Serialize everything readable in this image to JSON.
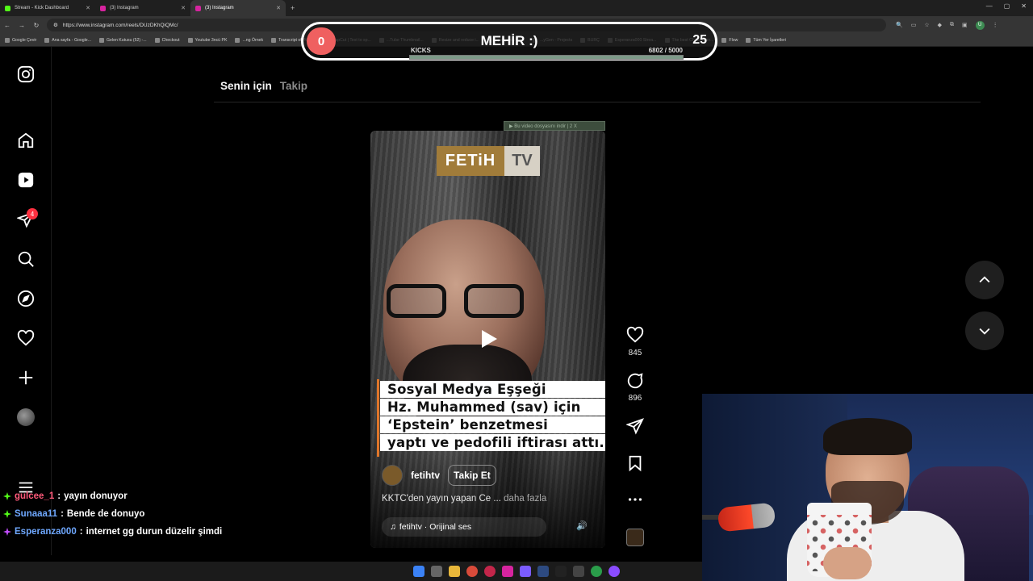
{
  "browser": {
    "tabs": [
      {
        "label": "Stream - Kick Dashboard",
        "color": "#53fc18"
      },
      {
        "label": "(3) Instagram",
        "color": "#d6249f"
      },
      {
        "label": "(3) Instagram",
        "color": "#d6249f"
      }
    ],
    "url": "https://www.instagram.com/reels/DUzDKhQiQMc/",
    "bookmarks": [
      "Google Çevir",
      "Ana sayfa - Google...",
      "Gelen Kutusu (52) -...",
      "Checkout",
      "Youtube 3ncü PK",
      "...ng Örnek",
      "Transcript of \"Ml M...",
      "CapCut | Text to sp...",
      "...Tube Thumbnail...",
      "Resize and reduce i...",
      "İspanyolca Öz...",
      "...yGen - Projects",
      "BURÇ",
      "Esperanza000 Strea...",
      "The best ChatBot an...",
      "Flow",
      "Tüm Yer İşaretleri"
    ]
  },
  "kick_overlay": {
    "left_value": "0",
    "title": "MEHİR :)",
    "right_value": "25",
    "label": "KICKS",
    "count_text": "6802  / 5000",
    "progress_fraction": 1.0,
    "color": "#ef6060"
  },
  "instagram": {
    "sidebar": {
      "notification_count": "4",
      "items": [
        "instagram-logo",
        "home",
        "reels",
        "messages",
        "search",
        "explore",
        "notifications",
        "create",
        "profile",
        "more"
      ]
    },
    "feed_tabs": {
      "active": "Senin için",
      "inactive": "Takip"
    },
    "reel": {
      "download_banner": "▶ Bu video dosyasını indir  | 2 X",
      "logo_left": "FETiH",
      "logo_right": "TV",
      "caption_lines": [
        "Sosyal Medya Eşşeği",
        "Hz. Muhammed (sav) için",
        "‘Epstein’ benzetmesi",
        "yaptı ve pedofili  iftirası attı."
      ],
      "author": "fetihtv",
      "follow_label": "Takip Et",
      "description": "KKTC'den yayın yapan Ce ...",
      "more_label": "daha fazla",
      "audio": "fetihtv · Orijinal ses",
      "likes": "845",
      "comments": "896"
    }
  },
  "chat": [
    {
      "user": "gulcee_1",
      "message": "yayın donuyor",
      "user_color": "#ff5a7a",
      "badge_color": "#53fc18"
    },
    {
      "user": "Sunaaa11",
      "message": "Bende de donuyo",
      "user_color": "#6fa8ff",
      "badge_color": "#53fc18"
    },
    {
      "user": "Esperanza000",
      "message": "internet gg durun düzelir şimdi",
      "user_color": "#6fa8ff",
      "badge_color": "#c24dff"
    }
  ],
  "colors": {
    "accent_like_badge": "#ff3040",
    "kick_green": "#53fc18"
  }
}
